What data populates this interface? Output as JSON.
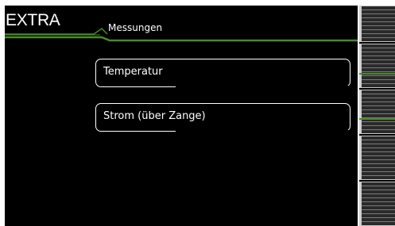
{
  "header": {
    "mode_title": "EXTRA",
    "tab_label": "Messungen"
  },
  "menu": {
    "items": [
      {
        "label": "Temperatur"
      },
      {
        "label": "Strom (über Zange)"
      }
    ]
  },
  "colors": {
    "background": "#000000",
    "text": "#ffffff",
    "accent_green": "#4a8a2a",
    "softkey_gray": "#2a2a2a"
  },
  "softkeys": {
    "count": 5,
    "active_marks": 2
  }
}
